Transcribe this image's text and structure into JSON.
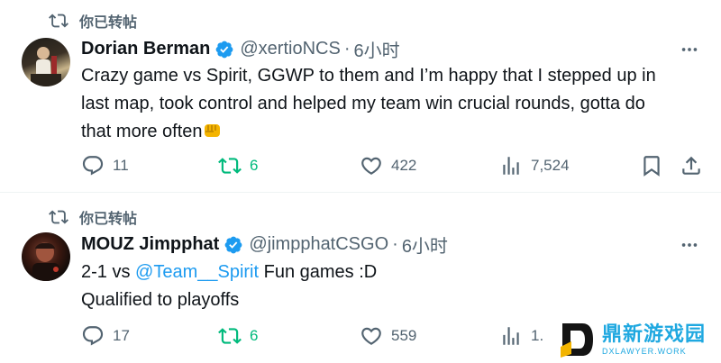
{
  "tweets": [
    {
      "retweet_label": "你已转帖",
      "name": "Dorian Berman",
      "handle": "@xertioNCS",
      "separator": "·",
      "time": "6小时",
      "lines": [
        "Crazy game vs Spirit, GGWP to them and I’m happy that I stepped up in",
        "last map, took control and helped my team win crucial rounds, gotta do",
        "that more often"
      ],
      "emoji_icon": "oncoming-fist-icon",
      "replies": "11",
      "reposts": "6",
      "likes": "422",
      "views": "7,524"
    },
    {
      "retweet_label": "你已转帖",
      "name": "MOUZ Jimpphat",
      "handle": "@jimpphatCSGO",
      "separator": "·",
      "time": "6小时",
      "line1_pre": "2-1 vs ",
      "mention": "@Team__Spirit",
      "line1_post": " Fun games :D",
      "line2": "Qualified to playoffs",
      "replies": "17",
      "reposts": "6",
      "likes": "559",
      "views": "1."
    }
  ],
  "watermark": {
    "name": "鼎新游戏园",
    "domain": "DXLAWYER.WORK"
  },
  "colors": {
    "text": "#0f1419",
    "secondary": "#536471",
    "verified": "#1d9bf0",
    "repost_active": "#00ba7c",
    "mention": "#1d9bf0"
  }
}
